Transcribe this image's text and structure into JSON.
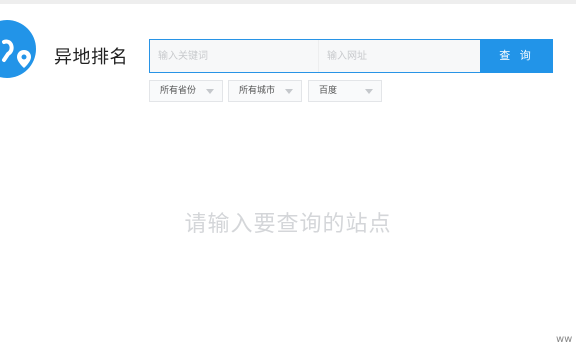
{
  "header": {
    "title": "异地排名"
  },
  "search": {
    "keyword_placeholder": "输入关键词",
    "url_placeholder": "输入网址",
    "button_label": "查 询"
  },
  "filters": {
    "province": "所有省份",
    "city": "所有城市",
    "engine": "百度"
  },
  "main": {
    "prompt": "请输入要查询的站点"
  },
  "watermark": "ww",
  "colors": {
    "accent": "#2294e8",
    "border": "#2894e6",
    "prompt": "#d4d6d9"
  },
  "icons": {
    "logo": "location-pin-icon"
  }
}
